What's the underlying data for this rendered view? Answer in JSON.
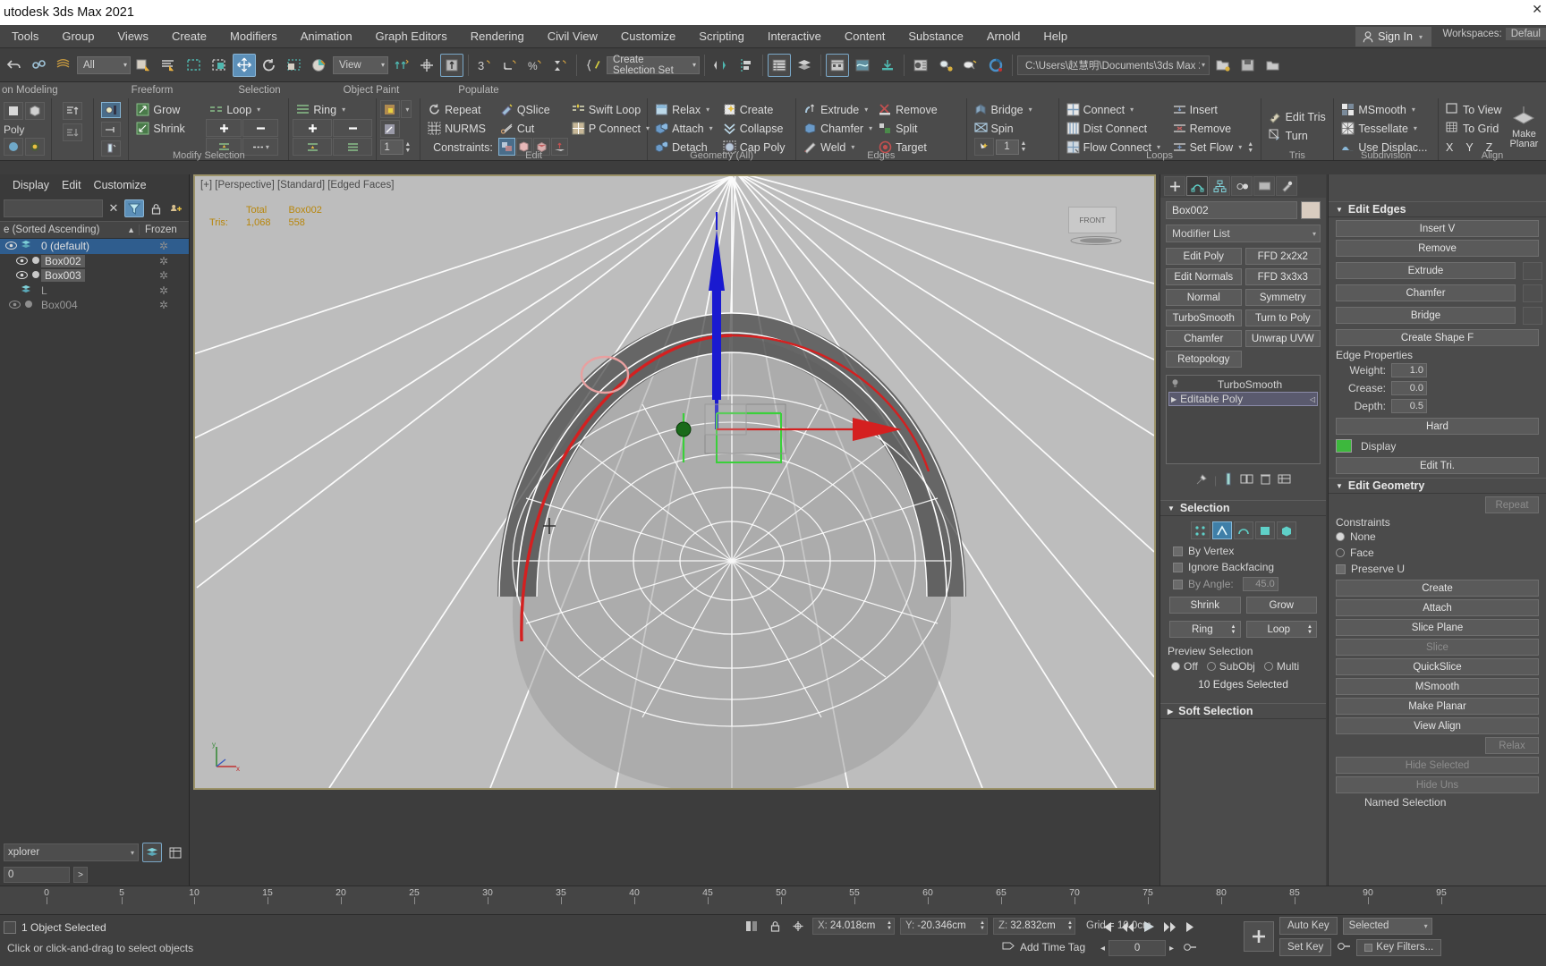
{
  "window": {
    "title": "utodesk 3ds Max 2021",
    "close_glyph": "✕"
  },
  "menubar": {
    "items": [
      "Tools",
      "Group",
      "Views",
      "Create",
      "Modifiers",
      "Animation",
      "Graph Editors",
      "Rendering",
      "Civil View",
      "Customize",
      "Scripting",
      "Interactive",
      "Content",
      "Substance",
      "Arnold",
      "Help"
    ],
    "sign_in": "Sign In",
    "workspaces_label": "Workspaces:",
    "workspaces_value": "Defaul"
  },
  "main_toolbar": {
    "selection_filter": "All",
    "reference_coord": "View",
    "named_selection_set": "Create Selection Set",
    "project_path": "C:\\Users\\赵慧明\\Documents\\3ds Max 2021",
    "icons": [
      "undo-icon",
      "redo-icon",
      "select-link-icon",
      "unlink-icon",
      "bind-spacewarp-icon",
      "select-object-icon",
      "select-by-name-icon",
      "rect-select-icon",
      "window-crossing-icon",
      "select-move-icon",
      "select-rotate-icon",
      "select-scale-icon",
      "placement-icon",
      "use-center-icon",
      "mirror-icon",
      "align-icon",
      "layer-explorer-icon",
      "curve-editor-icon",
      "schematic-view-icon",
      "material-editor-icon",
      "render-setup-icon",
      "render-frame-icon",
      "render-production-icon"
    ]
  },
  "ribbon": {
    "tabs_row": [
      "Freeform",
      "Selection",
      "Object Paint",
      "Populate"
    ],
    "left_tab": "on Modeling",
    "left_label": "Poly",
    "panels": [
      {
        "title": "Modify Selection",
        "items": [
          "Grow",
          "Shrink",
          "Loop",
          "Ring"
        ]
      },
      {
        "title": "Edit",
        "items": [
          "Repeat",
          "NURMS",
          "QSlice",
          "Cut",
          "Swift Loop",
          "P Connect",
          "Constraints:"
        ]
      },
      {
        "title": "Geometry (All)",
        "items": [
          "Relax",
          "Attach",
          "Detach",
          "Create",
          "Collapse",
          "Cap Poly"
        ]
      },
      {
        "title": "Edges",
        "items": [
          "Extrude",
          "Chamfer",
          "Weld",
          "Remove",
          "Split",
          "Target",
          "Bridge",
          "Spin"
        ]
      },
      {
        "title": "Loops",
        "items": [
          "Connect",
          "Dist Connect",
          "Flow Connect",
          "Insert",
          "Remove",
          "Set  Flow"
        ]
      },
      {
        "title": "Tris",
        "items": [
          "Edit Tris",
          "Turn"
        ]
      },
      {
        "title": "Subdivision",
        "items": [
          "MSmooth",
          "Tessellate",
          "Use Displac..."
        ]
      },
      {
        "title": "Align",
        "items": [
          "To View",
          "To Grid",
          "X",
          "Y",
          "Z",
          "Make Planar"
        ]
      }
    ],
    "constraint_count": "1",
    "edge_count": "1"
  },
  "explorer": {
    "menu": [
      "Display",
      "Edit",
      "Customize"
    ],
    "search_placeholder": "",
    "col_name": "e (Sorted Ascending)",
    "col_frozen": "Frozen",
    "sort_arrow": "▲",
    "rows": [
      {
        "name": "0 (default)",
        "selected": true,
        "type": "layer",
        "frozen": "✲"
      },
      {
        "name": "Box002",
        "selected": false,
        "type": "object",
        "highlight": true,
        "frozen": "✲"
      },
      {
        "name": "Box003",
        "selected": false,
        "type": "object",
        "highlight": true,
        "frozen": "✲"
      },
      {
        "name": "L",
        "selected": false,
        "type": "layer",
        "dim": true,
        "frozen": "✲"
      },
      {
        "name": "Box004",
        "selected": false,
        "type": "object",
        "dim": true,
        "frozen": "✲"
      }
    ],
    "footer_label": "xplorer",
    "footer_value": "0"
  },
  "viewport": {
    "label": "[+] [Perspective] [Standard] [Edged Faces]",
    "stats": {
      "row_label": "Tris:",
      "col_total": "Total",
      "col_object": "Box002",
      "total_value": "1,068",
      "object_value": "558"
    },
    "view_cube": "FRONT",
    "axis_x": "x",
    "axis_y": "y",
    "axis_z": "z"
  },
  "command_panel": {
    "tabs": [
      "create-tab",
      "modify-tab",
      "hierarchy-tab",
      "motion-tab",
      "display-tab",
      "utilities-tab"
    ],
    "object_name": "Box002",
    "modifier_list": "Modifier List",
    "modifier_buttons": [
      "Edit Poly",
      "FFD 2x2x2",
      "Edit Normals",
      "FFD 3x3x3",
      "Normal",
      "Symmetry",
      "TurboSmooth",
      "Turn to Poly",
      "Chamfer",
      "Unwrap UVW",
      "Retopology"
    ],
    "stack": [
      {
        "label": "TurboSmooth",
        "selected": false
      },
      {
        "label": "Editable Poly",
        "selected": true
      }
    ],
    "selection": {
      "title": "Selection",
      "subobject_icons": [
        "vertex-icon",
        "edge-icon",
        "border-icon",
        "polygon-icon",
        "element-icon"
      ],
      "active_subobject_index": 1,
      "by_vertex": "By Vertex",
      "ignore_backfacing": "Ignore Backfacing",
      "by_angle": "By Angle:",
      "by_angle_value": "45.0",
      "shrink": "Shrink",
      "grow": "Grow",
      "ring": "Ring",
      "loop": "Loop",
      "preview_selection": "Preview Selection",
      "preview_options": [
        "Off",
        "SubObj",
        "Multi"
      ],
      "preview_active": 0,
      "status": "10 Edges Selected"
    },
    "soft_selection": "Soft Selection"
  },
  "command_panel_2": {
    "edit_edges": {
      "title": "Edit Edges",
      "buttons": [
        "Insert V",
        "Remove",
        "Extrude",
        "Chamfer",
        "Bridge",
        "Create Shape F"
      ]
    },
    "edge_properties": {
      "title": "Edge Properties",
      "weight_label": "Weight:",
      "weight_value": "1.0",
      "crease_label": "Crease:",
      "crease_value": "0.0",
      "depth_label": "Depth:",
      "depth_value": "0.5",
      "hard": "Hard",
      "display": "Display",
      "edit_tri": "Edit Tri.",
      "color_swatch": "#3db83d"
    },
    "edit_geometry": {
      "title": "Edit Geometry",
      "buttons": [
        "Repeat",
        "Create",
        "Attach",
        "Slice Plane",
        "Slice",
        "QuickSlice",
        "MSmooth",
        "Make Planar",
        "View Align",
        "Relax",
        "Hide Selected",
        "Hide Uns",
        "Named Selection"
      ],
      "constraints_label": "Constraints",
      "constraint_none": "None",
      "constraint_face": "Face",
      "preserve": "Preserve U"
    }
  },
  "timeline": {
    "ticks": [
      "0",
      "5",
      "10",
      "15",
      "20",
      "25",
      "30",
      "35",
      "40",
      "45",
      "50",
      "55",
      "60",
      "65",
      "70",
      "75",
      "80",
      "85",
      "90",
      "95"
    ]
  },
  "statusbar": {
    "selection_message": "1 Object Selected",
    "prompt": "Click or click-and-drag to select objects",
    "coords": [
      {
        "label": "X:",
        "value": "24.018cm"
      },
      {
        "label": "Y:",
        "value": "-20.346cm"
      },
      {
        "label": "Z:",
        "value": "32.832cm"
      }
    ],
    "grid": "Grid = 10.0cm",
    "add_time_tag": "Add Time Tag",
    "auto_key": "Auto Key",
    "set_key": "Set Key",
    "selected_combo": "Selected",
    "key_filters": "Key Filters...",
    "key_value": "0",
    "transport": [
      "go-to-start-icon",
      "previous-frame-icon",
      "play-icon",
      "next-frame-icon",
      "go-to-end-icon"
    ]
  },
  "colors": {
    "accent_blue": "#3f7fa8",
    "viewport_bg": "#bdbdbd",
    "viewport_border": "#9b9268",
    "stat_text": "#b8860b",
    "gizmo_z": "#1a1ad0",
    "gizmo_x": "#d01a1a",
    "gizmo_y": "#1ad01a",
    "selected_edge": "#d42020"
  }
}
